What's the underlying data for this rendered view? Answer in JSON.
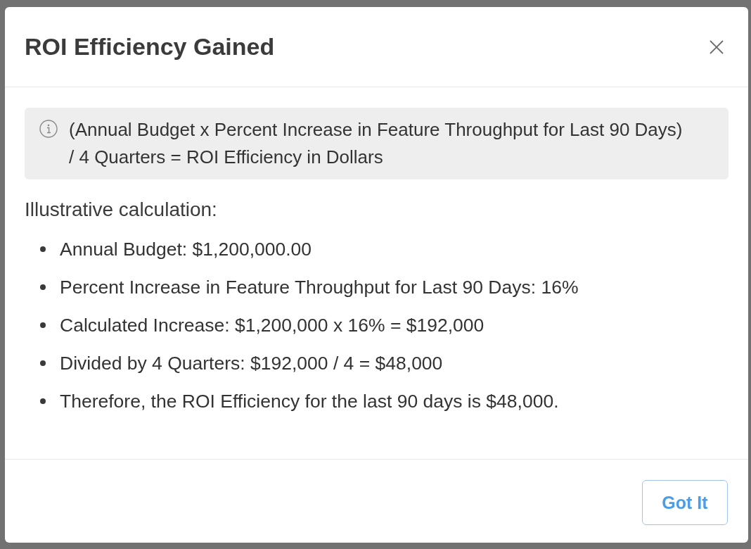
{
  "dialog": {
    "title": "ROI Efficiency Gained",
    "formula_note": "(Annual Budget x Percent Increase in Feature Throughput for Last 90 Days) / 4 Quarters = ROI Efficiency in Dollars",
    "section_heading": "Illustrative calculation:",
    "calculation_steps": [
      "Annual Budget: $1,200,000.00",
      "Percent Increase in Feature Throughput for Last 90 Days: 16%",
      "Calculated Increase: $1,200,000 x 16% = $192,000",
      "Divided by 4 Quarters: $192,000 / 4 = $48,000",
      "Therefore, the ROI Efficiency for the last 90 days is $48,000."
    ],
    "buttons": [
      "Got It"
    ]
  }
}
